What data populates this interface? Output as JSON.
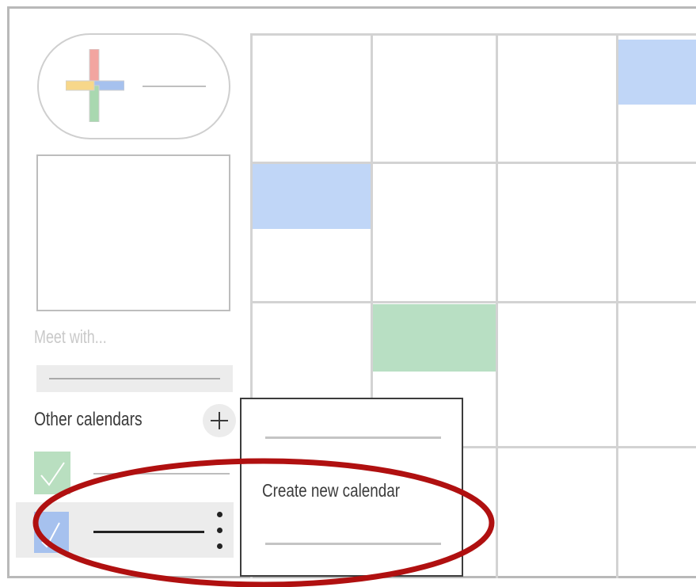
{
  "sidebar": {
    "create_button": {
      "icon": "multicolor-plus-icon"
    },
    "meet_with_placeholder": "Meet with...",
    "other_calendars": {
      "title": "Other calendars",
      "add_icon": "plus-icon",
      "items": [
        {
          "color": "#b9dfc0",
          "checked": true
        },
        {
          "color": "#a6c1ee",
          "checked": true
        }
      ]
    }
  },
  "menu": {
    "create_new_calendar": "Create new calendar"
  },
  "colors": {
    "event_blue": "#c0d6f7",
    "event_green": "#b8dfc3",
    "highlight_ellipse": "#b01010"
  }
}
